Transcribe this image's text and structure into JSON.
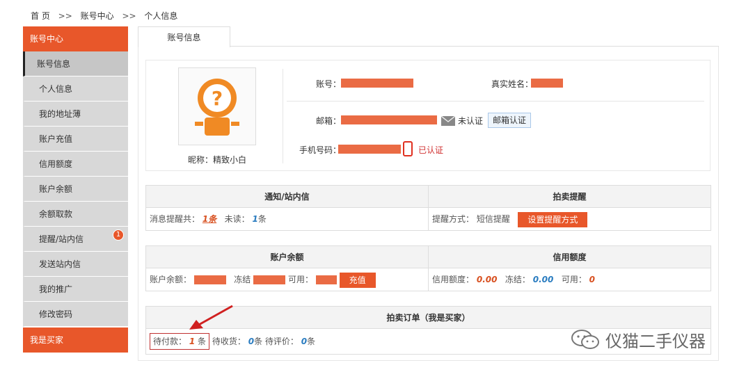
{
  "breadcrumb": {
    "home": "首 页",
    "sep": ">>",
    "level1": "账号中心",
    "level2": "个人信息"
  },
  "sidebar": {
    "header": "账号中心",
    "items": [
      {
        "label": "账号信息"
      },
      {
        "label": "个人信息"
      },
      {
        "label": "我的地址薄"
      },
      {
        "label": "账户充值"
      },
      {
        "label": "信用额度"
      },
      {
        "label": "账户余额"
      },
      {
        "label": "余额取款"
      },
      {
        "label": "提醒/站内信",
        "badge": "1"
      },
      {
        "label": "发送站内信"
      },
      {
        "label": "我的推广"
      },
      {
        "label": "修改密码"
      }
    ],
    "footer": "我是买家"
  },
  "tab": {
    "label": "账号信息"
  },
  "profile": {
    "nickname_label": "昵称：",
    "nickname": "精致小白",
    "account_label": "账号：",
    "realname_label": "真实姓名：",
    "email_label": "邮箱：",
    "email_status": "未认证",
    "email_verify_button": "邮箱认证",
    "phone_label": "手机号码：",
    "phone_status": "已认证"
  },
  "notices": {
    "header": "通知/站内信",
    "total_label": "消息提醒共：",
    "total": "1",
    "unit": "条",
    "unread_label": "未读：",
    "unread": "1"
  },
  "auction_reminder": {
    "header": "拍卖提醒",
    "method_label": "提醒方式：",
    "method": "短信提醒",
    "button": "设置提醒方式"
  },
  "balance": {
    "header": "账户余额",
    "balance_label": "账户余额：",
    "frozen_label": "冻结",
    "available_label": "可用：",
    "recharge_button": "充值"
  },
  "credit": {
    "header": "信用额度",
    "credit_label": "信用额度：",
    "credit": "0.00",
    "frozen_label": "冻结：",
    "frozen": "0.00",
    "available_label": "可用：",
    "available": "0"
  },
  "orders": {
    "header": "拍卖订单（我是买家）",
    "pending_pay_label": "待付款：",
    "pending_pay": "1",
    "pending_receive_label": "待收货：",
    "pending_receive": "0",
    "pending_review_label": "待评价：",
    "pending_review": "0",
    "unit": "条"
  },
  "watermark": {
    "text": "仪猫二手仪器"
  },
  "colors": {
    "accent": "#e8572a",
    "redact": "#ea6b44",
    "blue": "#2a7cc0"
  }
}
